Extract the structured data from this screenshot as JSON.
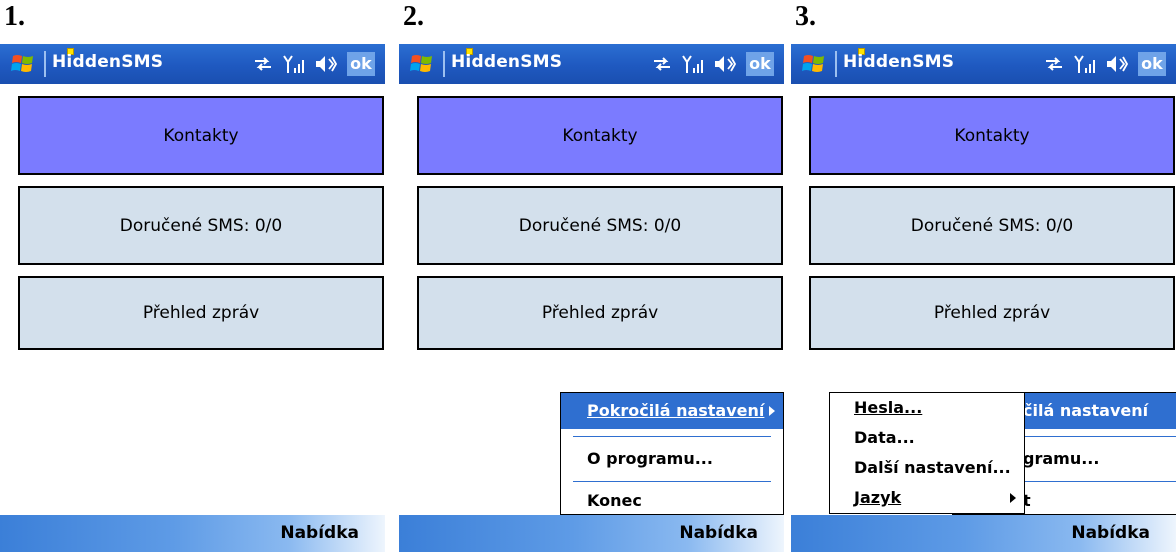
{
  "panels": [
    {
      "step": "1.",
      "app_title": "HiddenSMS",
      "ok_label": "ok",
      "buttons": [
        "Kontakty",
        "Doručené SMS: 0/0",
        "Přehled zpráv"
      ],
      "softkey": "Nabídka"
    },
    {
      "step": "2.",
      "app_title": "HiddenSMS",
      "ok_label": "ok",
      "buttons": [
        "Kontakty",
        "Doručené SMS: 0/0",
        "Přehled zpráv"
      ],
      "softkey": "Nabídka",
      "menu": {
        "items": [
          {
            "label": "Pokročilá nastavení",
            "selected": true,
            "submenu": true
          },
          {
            "label": "O programu...",
            "selected": false,
            "submenu": false
          },
          {
            "label": "Konec",
            "selected": false,
            "submenu": false
          }
        ]
      }
    },
    {
      "step": "3.",
      "app_title": "HiddenSMS",
      "ok_label": "ok",
      "buttons": [
        "Kontakty",
        "Doručené SMS: 0/0",
        "Přehled zpráv"
      ],
      "softkey": "Nabídka",
      "menu": {
        "items": [
          {
            "label": "čilá nastavení",
            "selected": true
          },
          {
            "label": "gramu...",
            "selected": false
          },
          {
            "label": "t",
            "selected": false
          }
        ]
      },
      "submenu": {
        "items": [
          {
            "label": "Hesla...",
            "submenu": false
          },
          {
            "label": "Data...",
            "submenu": false
          },
          {
            "label": "Další nastavení...",
            "submenu": false
          },
          {
            "label": "Jazyk",
            "submenu": true
          }
        ]
      }
    }
  ],
  "colors": {
    "titlebar": "#1f59c0",
    "kontakty_bg": "#7b7bff",
    "button_bg": "#d3e0ec",
    "menu_highlight": "#2f6fd0",
    "ok_bg": "#6fa3e8"
  },
  "icons": [
    "windows-start-icon",
    "sync-arrows-icon",
    "signal-icon",
    "speaker-icon"
  ]
}
